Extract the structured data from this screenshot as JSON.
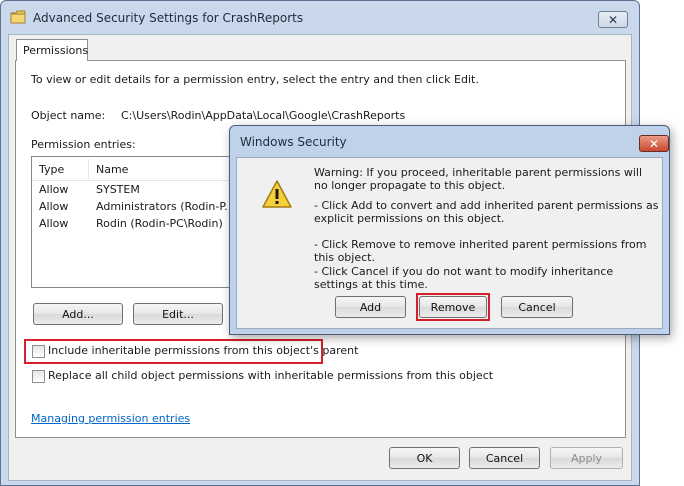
{
  "window": {
    "title": "Advanced Security Settings for CrashReports",
    "close_glyph": "✕"
  },
  "tabs": [
    {
      "label": "Permissions"
    }
  ],
  "permissions": {
    "intro": "To view or edit details for a permission entry, select the entry and then click Edit.",
    "object_name_label": "Object name:",
    "object_name_value": "C:\\Users\\Rodin\\AppData\\Local\\Google\\CrashReports",
    "entries_label": "Permission entries:",
    "columns": [
      "Type",
      "Name"
    ],
    "rows": [
      {
        "type": "Allow",
        "name": "SYSTEM"
      },
      {
        "type": "Allow",
        "name": "Administrators (Rodin-P..."
      },
      {
        "type": "Allow",
        "name": "Rodin (Rodin-PC\\Rodin)"
      }
    ],
    "add_label": "Add...",
    "edit_label": "Edit...",
    "include_inheritable_label": "Include inheritable permissions from this object's parent",
    "replace_child_label": "Replace all child object permissions with inheritable permissions from this object",
    "managing_link": "Managing permission entries"
  },
  "footer": {
    "ok_label": "OK",
    "cancel_label": "Cancel",
    "apply_label": "Apply"
  },
  "dialog": {
    "title": "Windows Security",
    "close_glyph": "✕",
    "warning": "Warning: If you proceed, inheritable parent permissions will no longer propagate to this object.",
    "option_add": "- Click Add to convert and add inherited parent permissions as explicit permissions on this object.",
    "option_remove": "- Click Remove to remove inherited parent permissions from this object.",
    "option_cancel": "- Click Cancel if you do not want to modify inheritance settings at this time.",
    "add_label": "Add",
    "remove_label": "Remove",
    "cancel_label": "Cancel"
  },
  "colors": {
    "highlight_box": "#d5202c",
    "link": "#0066cc"
  },
  "icons": {
    "window": "folder-icon",
    "dialog": "warning-icon"
  }
}
